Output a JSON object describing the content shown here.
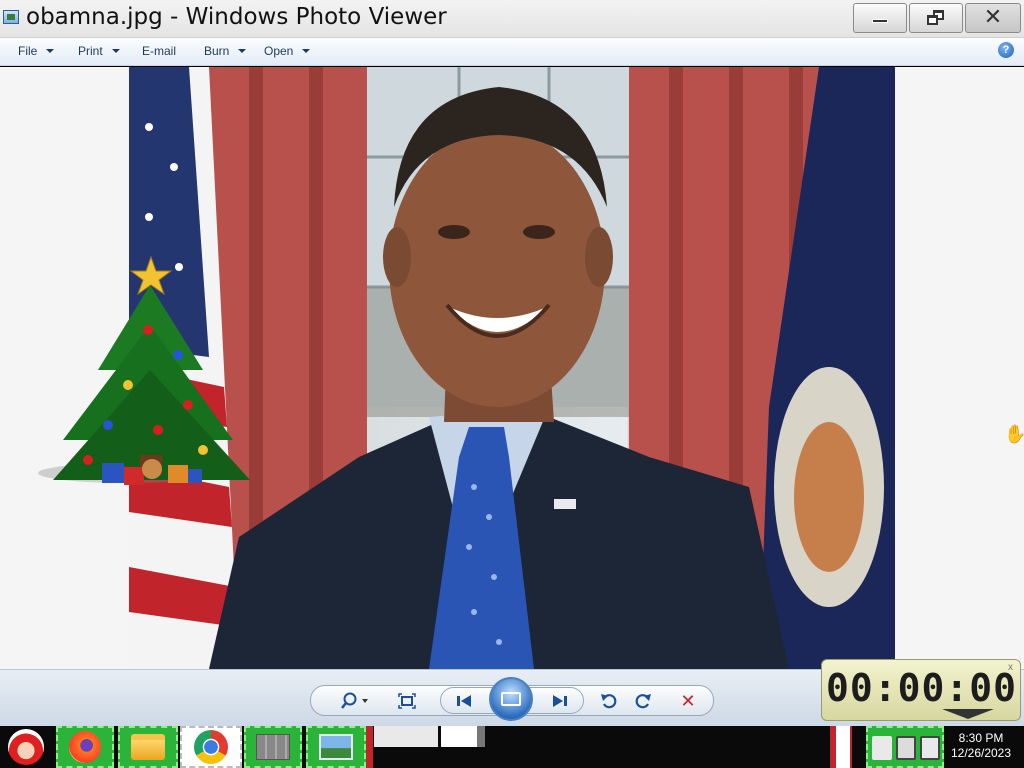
{
  "window": {
    "title": "obamna.jpg - Windows Photo Viewer"
  },
  "menu": {
    "file": "File",
    "print": "Print",
    "email": "E-mail",
    "burn": "Burn",
    "open": "Open",
    "help": "?"
  },
  "icons": {
    "minimize": "minimize-icon",
    "maximize": "restore-icon",
    "close": "close-icon",
    "zoom": "magnifier-icon",
    "fit": "actual-size-icon",
    "previous": "previous-icon",
    "slideshow": "slideshow-icon",
    "next": "next-icon",
    "rotate_ccw": "rotate-counterclockwise-icon",
    "rotate_cw": "rotate-clockwise-icon",
    "delete": "delete-icon"
  },
  "stopwatch": {
    "time": "00:00:00",
    "close": "x"
  },
  "taskbar": {
    "clock_time": "8:30 PM",
    "clock_date": "12/26/2023"
  },
  "colors": {
    "accent": "#1a4f9c",
    "delete": "#c4242b",
    "taskbar_tile": "#2bb33a"
  }
}
